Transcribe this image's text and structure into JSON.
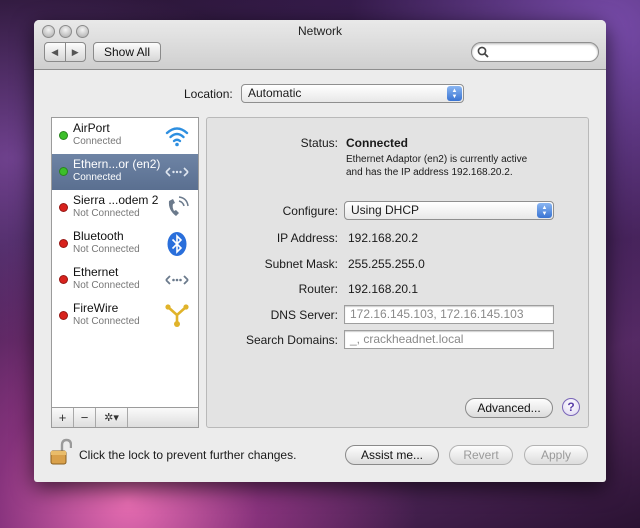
{
  "window": {
    "title": "Network"
  },
  "toolbar": {
    "back": "◀",
    "forward": "▶",
    "show_all_label": "Show All",
    "search_value": ""
  },
  "location": {
    "label": "Location:",
    "value": "Automatic"
  },
  "services": [
    {
      "name": "AirPort",
      "status": "Connected",
      "state": "green",
      "icon": "wifi-icon"
    },
    {
      "name": "Ethern...or (en2)",
      "status": "Connected",
      "state": "green",
      "icon": "ethernet-arrows-icon",
      "selected": true
    },
    {
      "name": "Sierra ...odem 2",
      "status": "Not Connected",
      "state": "red",
      "icon": "phone-icon"
    },
    {
      "name": "Bluetooth",
      "status": "Not Connected",
      "state": "red",
      "icon": "bluetooth-icon"
    },
    {
      "name": "Ethernet",
      "status": "Not Connected",
      "state": "red",
      "icon": "ethernet-icon"
    },
    {
      "name": "FireWire",
      "status": "Not Connected",
      "state": "red",
      "icon": "firewire-icon"
    }
  ],
  "list_controls": {
    "add": "+",
    "remove": "−",
    "action": "✲▾"
  },
  "detail": {
    "status_label": "Status:",
    "status_value": "Connected",
    "status_desc_1": "Ethernet Adaptor (en2) is currently active",
    "status_desc_2": "and has the IP address 192.168.20.2.",
    "configure_label": "Configure:",
    "configure_value": "Using DHCP",
    "ip_label": "IP Address:",
    "ip_value": "192.168.20.2",
    "subnet_label": "Subnet Mask:",
    "subnet_value": "255.255.255.0",
    "router_label": "Router:",
    "router_value": "192.168.20.1",
    "dns_label": "DNS Server:",
    "dns_value": "172.16.145.103, 172.16.145.103",
    "search_label": "Search Domains:",
    "search_value": "_, crackheadnet.local",
    "advanced_label": "Advanced...",
    "help_label": "?"
  },
  "footer": {
    "lock_text": "Click the lock to prevent further changes.",
    "assist_label": "Assist me...",
    "revert_label": "Revert",
    "apply_label": "Apply"
  },
  "colors": {
    "dot_green": "#3cbf2a",
    "dot_red": "#d8221d",
    "selection": "#6a7f9f"
  }
}
